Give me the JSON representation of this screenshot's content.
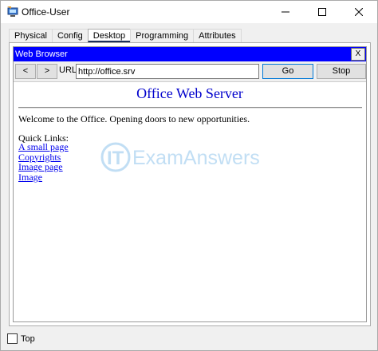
{
  "window": {
    "title": "Office-User",
    "icon": "packet-tracer-pc-icon"
  },
  "tabs": [
    {
      "label": "Physical"
    },
    {
      "label": "Config"
    },
    {
      "label": "Desktop",
      "active": true
    },
    {
      "label": "Programming"
    },
    {
      "label": "Attributes"
    }
  ],
  "browser": {
    "title": "Web Browser",
    "close_label": "X",
    "back_label": "<",
    "forward_label": ">",
    "url_label": "URL",
    "url_value": "http://office.srv",
    "go_label": "Go",
    "stop_label": "Stop"
  },
  "page": {
    "heading": "Office Web Server",
    "welcome": "Welcome to the Office. Opening doors to new opportunities.",
    "quick_links_label": "Quick Links:",
    "links": [
      "A small page",
      "Copyrights",
      "Image page",
      "Image"
    ]
  },
  "watermark": {
    "prefix": "IT",
    "text": "ExamAnswers"
  },
  "footer": {
    "top_label": "Top",
    "top_checked": false
  },
  "colors": {
    "browser_title_bg": "#0000ff",
    "heading": "#0000cc",
    "link": "#0000ee"
  }
}
